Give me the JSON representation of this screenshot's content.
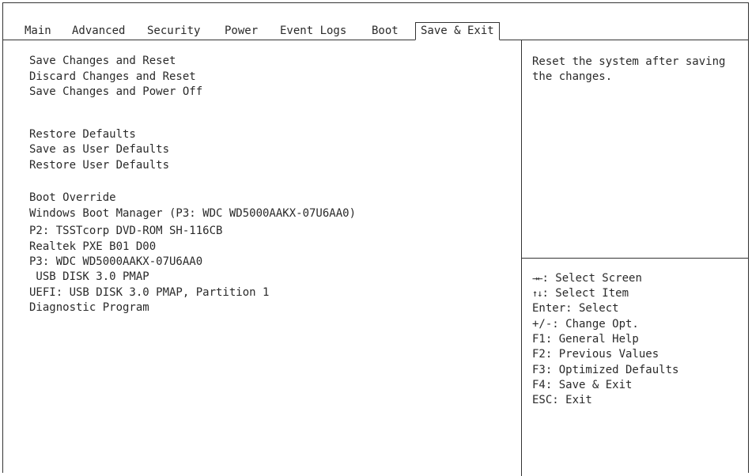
{
  "tabs": [
    {
      "label": "Main"
    },
    {
      "label": "Advanced"
    },
    {
      "label": "Security"
    },
    {
      "label": "Power"
    },
    {
      "label": "Event Logs"
    },
    {
      "label": "Boot"
    },
    {
      "label": "Save & Exit",
      "active": true
    }
  ],
  "menu": {
    "items": [
      {
        "label": "Save Changes and Reset"
      },
      {
        "label": "Discard Changes and Reset"
      },
      {
        "label": "Save Changes and Power Off"
      },
      {
        "label": "Restore Defaults"
      },
      {
        "label": "Save as User Defaults"
      },
      {
        "label": "Restore User Defaults"
      },
      {
        "label": "Boot Override"
      },
      {
        "label": "Windows Boot Manager (P3: WDC WD5000AAKX-07U6AA0)"
      },
      {
        "label": "P2: TSSTcorp DVD-ROM SH-116CB"
      },
      {
        "label": "Realtek PXE B01 D00"
      },
      {
        "label": "P3: WDC WD5000AAKX-07U6AA0"
      },
      {
        "label": " USB DISK 3.0 PMAP"
      },
      {
        "label": "UEFI: USB DISK 3.0 PMAP, Partition 1"
      },
      {
        "label": "Diagnostic Program"
      }
    ]
  },
  "help": {
    "description": "Reset the system after saving the changes."
  },
  "keys": {
    "select_screen": {
      "glyph": "→←",
      "text": ": Select Screen"
    },
    "select_item": {
      "glyph": "↑↓",
      "text": ": Select Item"
    },
    "lines": [
      "Enter: Select",
      "+/-: Change Opt.",
      "F1: General Help",
      "F2: Previous Values",
      "F3: Optimized Defaults",
      "F4: Save & Exit",
      "ESC: Exit"
    ]
  },
  "colors": {
    "text": "#2a2a2a",
    "border": "#333333",
    "background": "#ffffff"
  }
}
